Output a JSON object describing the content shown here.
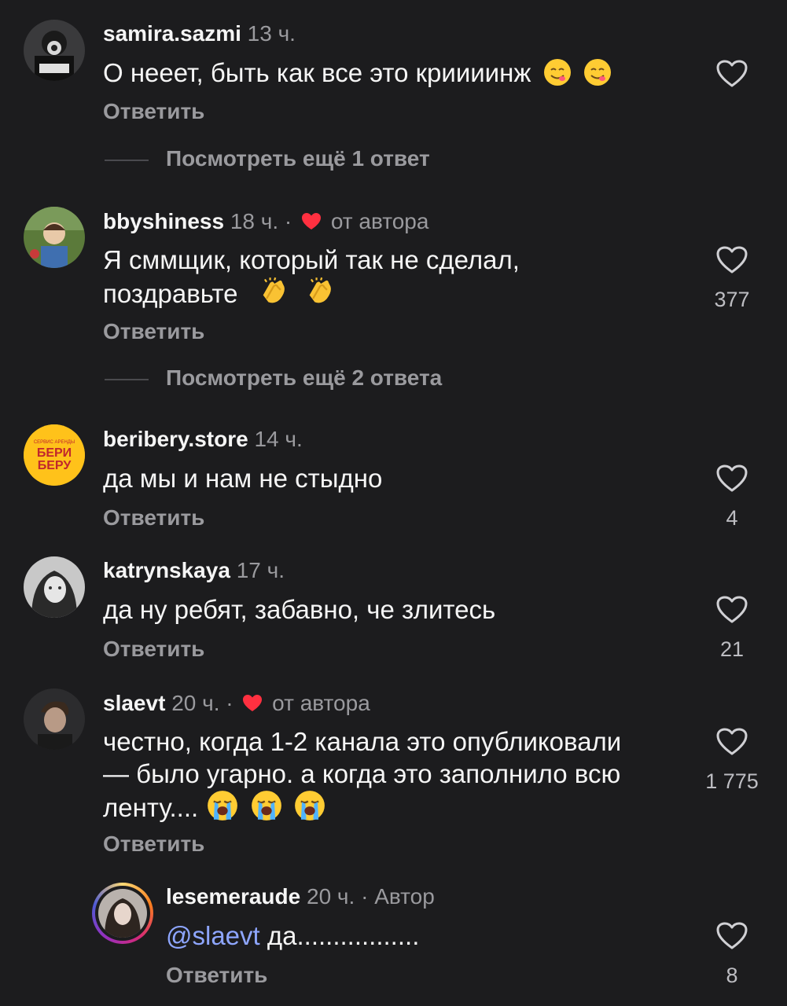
{
  "reply_label": "Ответить",
  "author_label": "от автора",
  "comments": [
    {
      "username": "samira.sazmi",
      "time": "13 ч.",
      "text": "О нееет, быть как все это криииинж",
      "emojis": [
        "face-savoring-food",
        "face-savoring-food"
      ],
      "likes": ""
    },
    {
      "username": "bbyshiness",
      "time": "18 ч.",
      "author_liked": true,
      "text_line1": "Я сммщик, который так не сделал,",
      "text_line2": "поздравьте",
      "emojis": [
        "clapping-hands",
        "clapping-hands"
      ],
      "likes": "377"
    },
    {
      "username": "beribery.store",
      "time": "14 ч.",
      "text": "да мы и нам не стыдно",
      "likes": "4",
      "avatar_text_1": "СЕРВИС АРЕНДЫ",
      "avatar_text_2": "БЕРИ",
      "avatar_text_3": "БЕРУ"
    },
    {
      "username": "katrynskaya",
      "time": "17 ч.",
      "text": "да ну ребят, забавно, че злитесь",
      "likes": "21"
    },
    {
      "username": "slaevt",
      "time": "20 ч.",
      "author_liked": true,
      "text_line1": "честно, когда 1-2 канала это опубликовали",
      "text_line2": "— было угарно. а когда это заполнило всю",
      "text_line3": "ленту....",
      "emojis": [
        "loudly-crying-face",
        "loudly-crying-face",
        "loudly-crying-face"
      ],
      "likes": "1 775"
    },
    {
      "username": "lesemeraude",
      "time": "20 ч.",
      "author_badge": "Автор",
      "mention": "@slaevt",
      "text": " да.................",
      "likes": "8"
    }
  ],
  "more_replies": [
    {
      "label": "Посмотреть ещё 1 ответ"
    },
    {
      "label": "Посмотреть ещё 2 ответа"
    }
  ],
  "colors": {
    "background": "#1c1c1e",
    "text": "#f5f5f5",
    "secondary": "#9a9a9e",
    "mention": "#8ea6ff",
    "heart_red": "#ff3040",
    "avatar_yellow": "#ffc21a"
  }
}
